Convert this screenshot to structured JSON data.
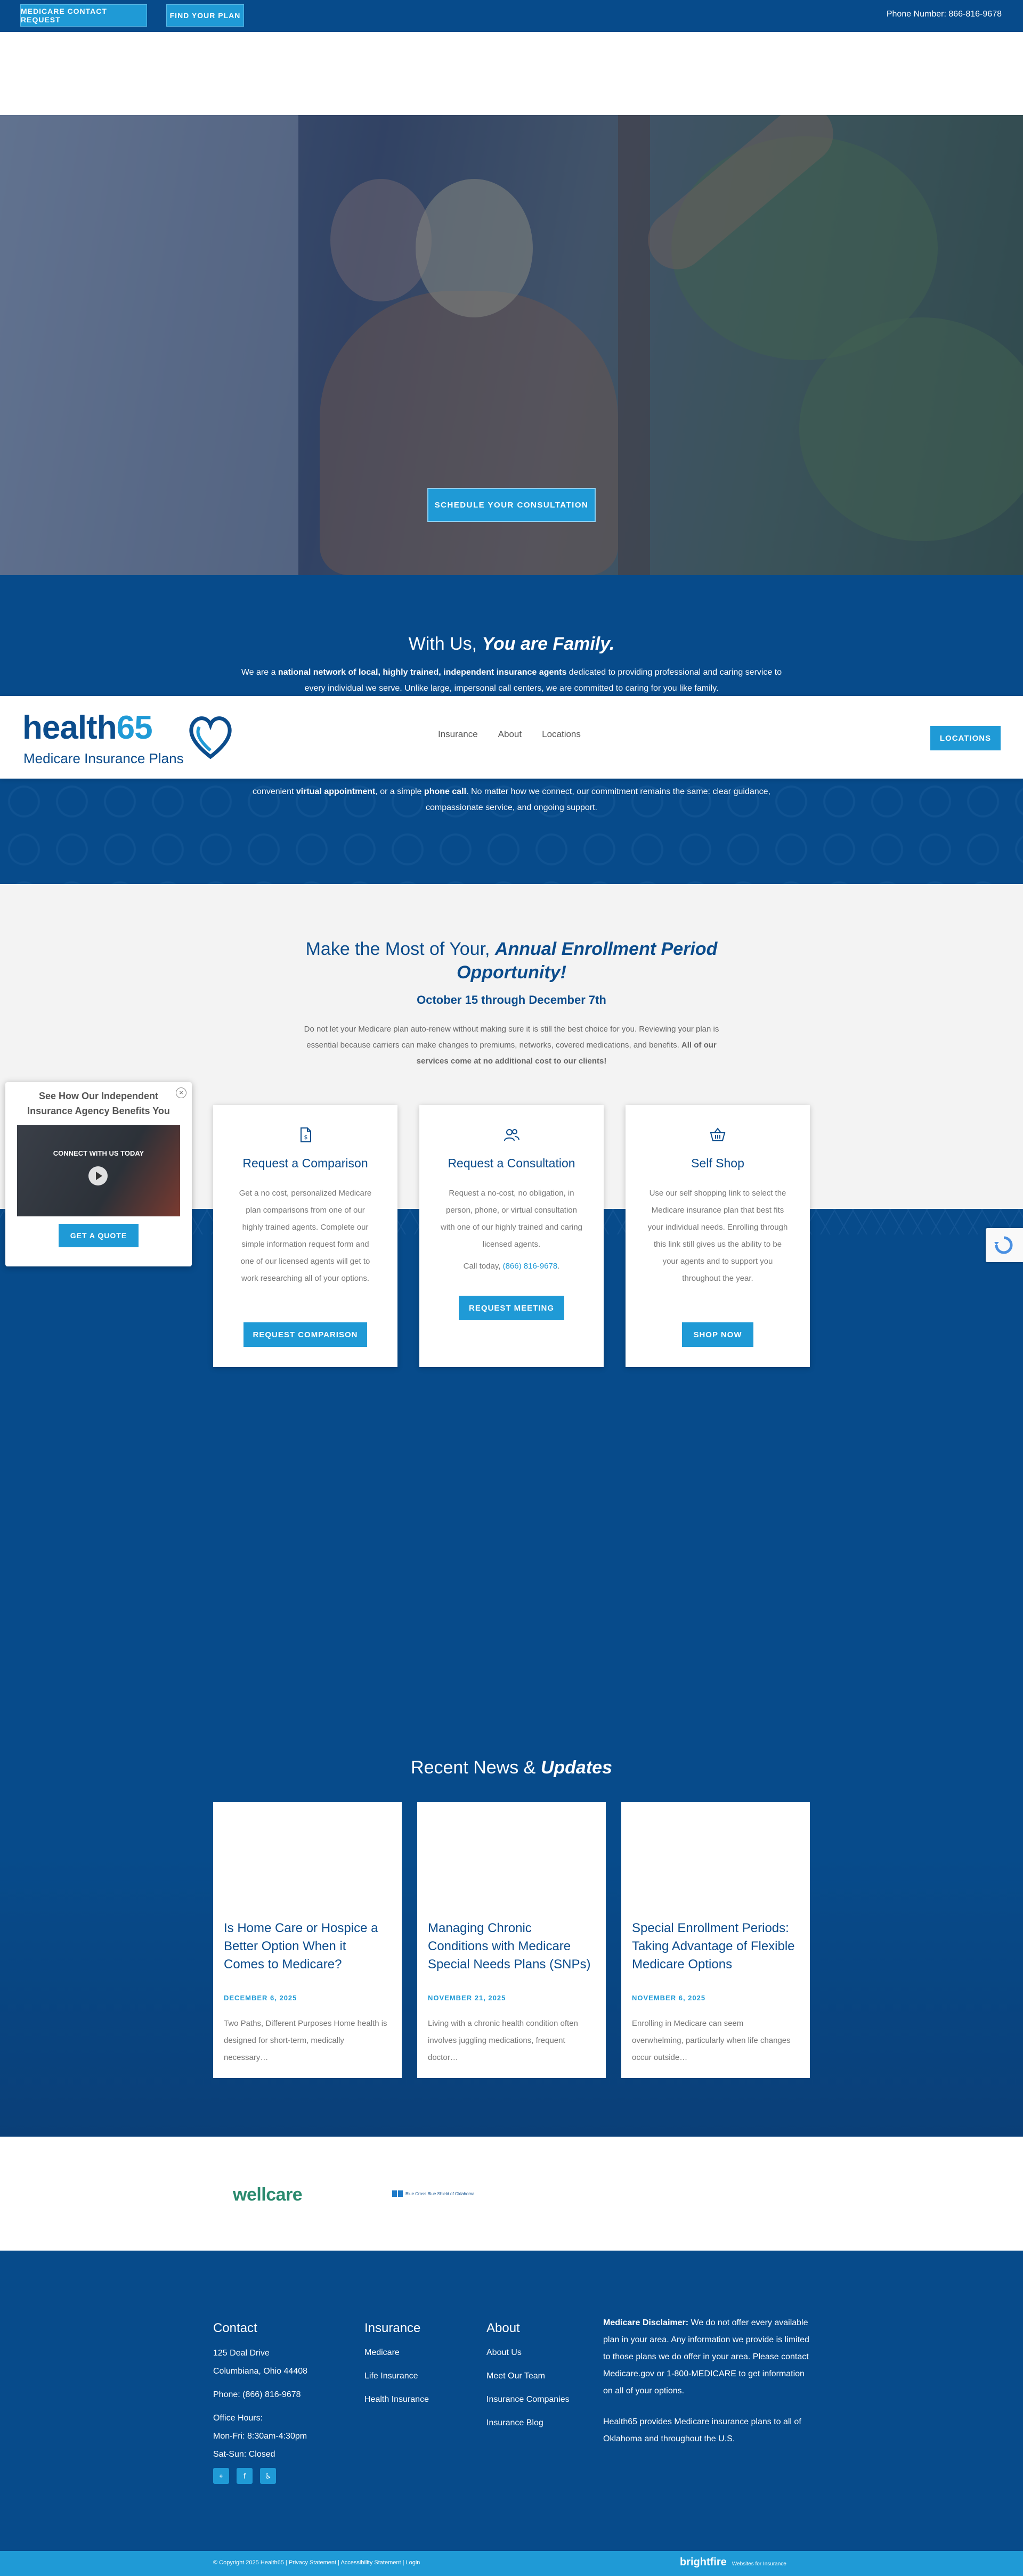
{
  "topbar": {
    "contact_label": "MEDICARE CONTACT REQUEST",
    "find_plan_label": "FIND YOUR PLAN",
    "phone": "Phone Number: 866-816-9678"
  },
  "hero": {
    "cta_label": "SCHEDULE YOUR CONSULTATION"
  },
  "header": {
    "logo_word": "health",
    "logo_num": "65",
    "logo_tag": "Medicare Insurance Plans",
    "nav": [
      "Insurance",
      "About",
      "Locations"
    ],
    "cta_label": "LOCATIONS"
  },
  "family": {
    "title_plain": "With Us, ",
    "title_em": "You are Family.",
    "p1_a": "We are a ",
    "p1_b": "national network of local, highly trained, independent insurance agents",
    "p1_c": " dedicated to providing professional and caring service to every individual we serve. Unlike large, impersonal call centers, we are committed to caring for you like family.",
    "p2_a": "convenient ",
    "p2_b": "virtual appointment",
    "p2_c": ", or a simple ",
    "p2_d": "phone call",
    "p2_e": ". No matter how we connect, our commitment remains the same: clear guidance, compassionate service, and ongoing support."
  },
  "enroll": {
    "title_plain": "Make the Most of Your, ",
    "title_em": "Annual Enrollment Period Opportunity!",
    "dates": "October 15 through December 7th",
    "desc_a": "Do not let your Medicare plan auto-renew without making sure it is still the best choice for you. Reviewing your plan is essential because carriers can make changes to premiums, networks, covered medications, and benefits. ",
    "desc_b": "All of our services come at no additional cost to our clients!"
  },
  "cards": [
    {
      "icon": "document-dollar-icon",
      "title": "Request a Comparison",
      "text": "Get a no cost, personalized Medicare plan comparisons from one of our highly trained agents. Complete our simple information request form and one of our licensed agents will get to work researching all of your options.",
      "button": "REQUEST COMPARISON"
    },
    {
      "icon": "people-icon",
      "title": "Request a Consultation",
      "text": "Request a no-cost, no obligation, in person, phone, or virtual consultation with one of our highly trained and caring licensed agents.",
      "call_prefix": "Call today, ",
      "call_number": "(866) 816-9678",
      "call_suffix": ".",
      "button": "REQUEST MEETING"
    },
    {
      "icon": "basket-icon",
      "title": "Self Shop",
      "text": "Use our self shopping link to select the Medicare insurance plan that best fits your individual needs. Enrolling through this link still gives us the ability to be your agents and to support you throughout the year.",
      "button": "SHOP NOW"
    }
  ],
  "popup": {
    "title": "See How Our Independent Insurance Agency Benefits You",
    "video_text": "CONNECT WITH US TODAY",
    "button": "GET A QUOTE",
    "close": "×"
  },
  "news": {
    "title_plain": "Recent News & ",
    "title_em": "Updates",
    "items": [
      {
        "title": "Is Home Care or Hospice a Better Option When it Comes to Medicare?",
        "date": "DECEMBER 6, 2025",
        "excerpt": "Two Paths, Different Purposes Home health is designed for short-term, medically necessary…"
      },
      {
        "title": "Managing Chronic Conditions with Medicare Special Needs Plans (SNPs)",
        "date": "NOVEMBER 21, 2025",
        "excerpt": "Living with a chronic health condition often involves juggling medications, frequent doctor…"
      },
      {
        "title": "Special Enrollment Periods: Taking Advantage of Flexible Medicare Options",
        "date": "NOVEMBER 6, 2025",
        "excerpt": "Enrolling in Medicare can seem overwhelming, particularly when life changes occur outside…"
      }
    ]
  },
  "partners": {
    "wellcare": "wellcare",
    "bcbs": "Blue Cross Blue Shield of Oklahoma"
  },
  "footer": {
    "contact_title": "Contact",
    "address1": "125 Deal Drive",
    "address2": "Columbiana, Ohio 44408",
    "phone": "Phone: (866) 816-9678",
    "hours_title": "Office Hours:",
    "hours1": "Mon-Fri: 8:30am-4:30pm",
    "hours2": "Sat-Sun: Closed",
    "insurance_title": "Insurance",
    "insurance_links": [
      "Medicare",
      "Life Insurance",
      "Health Insurance"
    ],
    "about_title": "About",
    "about_links": [
      "About Us",
      "Meet Our Team",
      "Insurance Companies",
      "Insurance Blog"
    ],
    "disclaimer_label": "Medicare Disclaimer:",
    "disclaimer_text": " We do not offer every available plan in your area. Any information we provide is limited to those plans we do offer in your area. Please contact Medicare.gov or 1-800-MEDICARE to get information on all of your options.",
    "states_text": "Health65 provides Medicare insurance plans to all of Oklahoma and throughout the U.S."
  },
  "bottombar": {
    "copyright": "© Copyright 2025 Health65 | Privacy Statement | Accessibility Statement | Login",
    "brand": "brightfire",
    "brand_sub": "Websites for Insurance"
  },
  "colors": {
    "navy": "#074b8b",
    "accent": "#1f9ad6"
  }
}
